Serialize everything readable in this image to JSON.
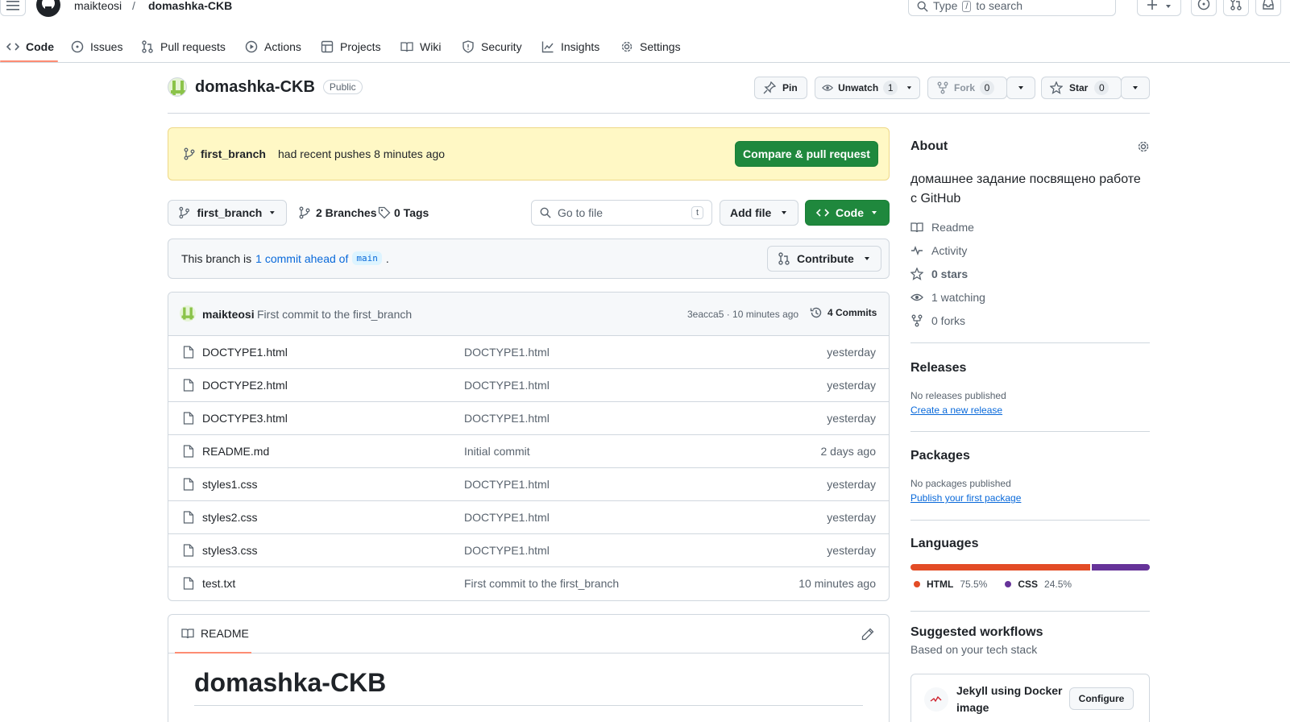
{
  "header": {
    "owner": "maikteosi",
    "separator": "/",
    "repo": "domashka-CKB",
    "search_prefix": "Type",
    "search_key": "/",
    "search_suffix": "to search"
  },
  "nav": {
    "tabs": [
      {
        "label": "Code",
        "icon": "code-icon"
      },
      {
        "label": "Issues",
        "icon": "issue-icon"
      },
      {
        "label": "Pull requests",
        "icon": "pull-request-icon"
      },
      {
        "label": "Actions",
        "icon": "play-icon"
      },
      {
        "label": "Projects",
        "icon": "table-icon"
      },
      {
        "label": "Wiki",
        "icon": "book-icon"
      },
      {
        "label": "Security",
        "icon": "shield-icon"
      },
      {
        "label": "Insights",
        "icon": "graph-icon"
      },
      {
        "label": "Settings",
        "icon": "gear-icon"
      }
    ]
  },
  "repo": {
    "name": "domashka-CKB",
    "visibility": "Public",
    "pin_label": "Pin",
    "unwatch_label": "Unwatch",
    "watch_count": "1",
    "fork_label": "Fork",
    "fork_count": "0",
    "star_label": "Star",
    "star_count": "0"
  },
  "flash": {
    "branch": "first_branch",
    "message": "had recent pushes 8 minutes ago",
    "button": "Compare & pull request"
  },
  "controls": {
    "branch": "first_branch",
    "branches": "2 Branches",
    "tags": "0 Tags",
    "goto_placeholder": "Go to file",
    "goto_key": "t",
    "add_file": "Add file",
    "code_button": "Code"
  },
  "ahead": {
    "prefix": "This branch is",
    "link": "1 commit ahead of",
    "base": "main",
    "suffix": ".",
    "contribute": "Contribute"
  },
  "commit": {
    "author": "maikteosi",
    "message": "First commit to the first_branch",
    "meta": "3eacca5 · 10 minutes ago",
    "count": "4 Commits"
  },
  "files": [
    {
      "name": "DOCTYPE1.html",
      "message": "DOCTYPE1.html",
      "time": "yesterday"
    },
    {
      "name": "DOCTYPE2.html",
      "message": "DOCTYPE1.html",
      "time": "yesterday"
    },
    {
      "name": "DOCTYPE3.html",
      "message": "DOCTYPE1.html",
      "time": "yesterday"
    },
    {
      "name": "README.md",
      "message": "Initial commit",
      "time": "2 days ago"
    },
    {
      "name": "styles1.css",
      "message": "DOCTYPE1.html",
      "time": "yesterday"
    },
    {
      "name": "styles2.css",
      "message": "DOCTYPE1.html",
      "time": "yesterday"
    },
    {
      "name": "styles3.css",
      "message": "DOCTYPE1.html",
      "time": "yesterday"
    },
    {
      "name": "test.txt",
      "message": "First commit to the first_branch",
      "time": "10 minutes ago"
    }
  ],
  "readme": {
    "tab": "README",
    "heading": "domashka-CKB"
  },
  "about": {
    "title": "About",
    "description": "домашнее задание посвящено работе с GitHub",
    "links": [
      {
        "label": "Readme",
        "icon": "book-icon"
      },
      {
        "label": "Activity",
        "icon": "pulse-icon"
      },
      {
        "label": "0 stars",
        "icon": "star-icon"
      },
      {
        "label": "1 watching",
        "icon": "eye-icon"
      },
      {
        "label": "0 forks",
        "icon": "fork-icon"
      }
    ]
  },
  "releases": {
    "title": "Releases",
    "empty": "No releases published",
    "link": "Create a new release"
  },
  "packages": {
    "title": "Packages",
    "empty": "No packages published",
    "link": "Publish your first package"
  },
  "languages": {
    "title": "Languages",
    "items": [
      {
        "name": "HTML",
        "percent": "75.5%",
        "value": 75.5,
        "color": "#e34c26"
      },
      {
        "name": "CSS",
        "percent": "24.5%",
        "value": 24.5,
        "color": "#663399"
      }
    ]
  },
  "workflows": {
    "title": "Suggested workflows",
    "subtitle": "Based on your tech stack",
    "card_title": "Jekyll using Docker image",
    "configure": "Configure"
  },
  "colors": {
    "accent": "#0969da",
    "green": "#1f883d",
    "flash_bg": "#fff8c5",
    "nav_underline": "#fd8c73"
  }
}
